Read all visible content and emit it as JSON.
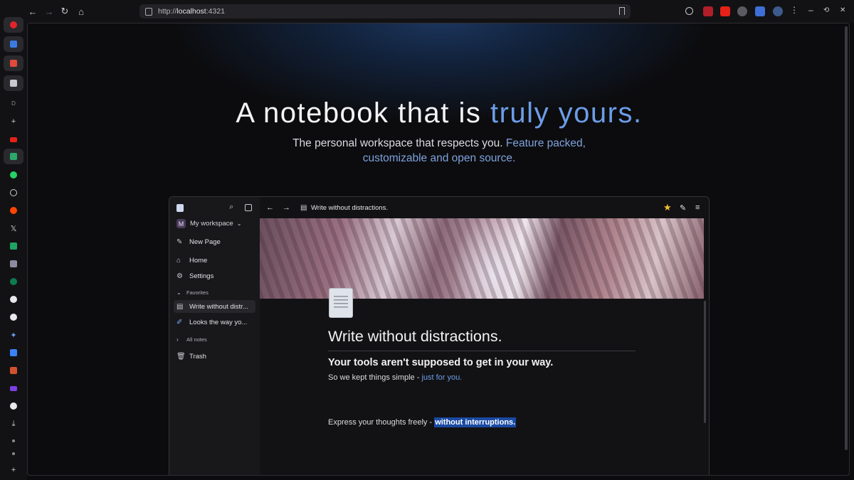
{
  "browser": {
    "url_scheme": "http://",
    "url_host": "localhost",
    "url_port": ":4321",
    "sidebar_letter": "D",
    "win_min": "–",
    "win_restore": "⟲",
    "win_close": "✕"
  },
  "hero": {
    "title_plain": "A notebook that is ",
    "title_accent": "truly yours.",
    "subtitle_plain": "The personal workspace that respects you. ",
    "subtitle_accent_1": "Feature packed,",
    "subtitle_accent_2": "customizable and open source."
  },
  "app": {
    "workspace_badge": "M",
    "workspace_name": "My workspace",
    "new_page": "New Page",
    "home": "Home",
    "settings": "Settings",
    "favorites": "Favorites",
    "fav_1": "Write without distr...",
    "fav_2": "Looks the way yo...",
    "all_notes": "All notes",
    "trash": "Trash",
    "header_title": "Write without distractions."
  },
  "doc": {
    "title": "Write without distractions.",
    "heading": "Your tools aren't supposed to get in your way.",
    "para_plain": "So we kept things simple - ",
    "para_accent": "just for you.",
    "para2_plain": "Express your thoughts freely - ",
    "para2_highlight": "without interruptions."
  },
  "colors": {
    "accent": "#6c9de8",
    "highlight": "#1a4aa3",
    "background": "#0c0c0e"
  }
}
